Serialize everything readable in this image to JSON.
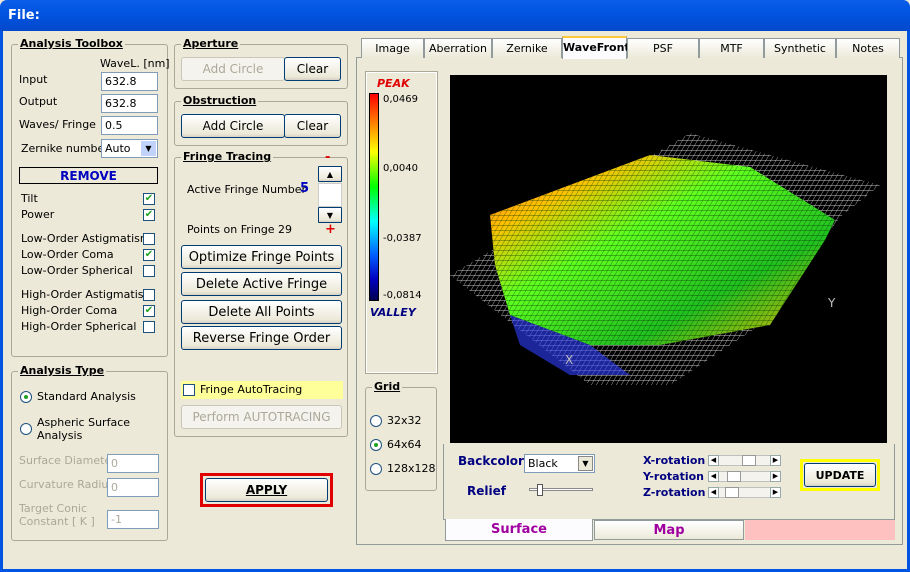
{
  "window": {
    "title": "File:"
  },
  "toolbox": {
    "title": "Analysis Toolbox",
    "wavel_header": "WaveL. [nm]",
    "input_label": "Input",
    "input_value": "632.8",
    "output_label": "Output",
    "output_value": "632.8",
    "waves_label": "Waves/ Fringe",
    "waves_value": "0.5",
    "zernike_label": "Zernike number",
    "zernike_value": "Auto",
    "remove_label": "REMOVE",
    "terms": [
      {
        "label": "Tilt",
        "checked": true
      },
      {
        "label": "Power",
        "checked": true
      },
      {
        "label": "Low-Order  Astigmatism",
        "checked": false
      },
      {
        "label": "Low-Order  Coma",
        "checked": true
      },
      {
        "label": "Low-Order  Spherical",
        "checked": false
      },
      {
        "label": "High-Order  Astigmatism",
        "checked": false
      },
      {
        "label": "High-Order  Coma",
        "checked": true
      },
      {
        "label": "High-Order  Spherical",
        "checked": false
      }
    ]
  },
  "analysis_type": {
    "title": "Analysis Type",
    "standard": "Standard  Analysis",
    "aspheric_line1": "Aspheric  Surface",
    "aspheric_line2": "Analysis",
    "surface_diameter_label": "Surface Diameter",
    "surface_diameter_value": "0",
    "curvature_radius_label": "Curvature Radius",
    "curvature_radius_value": "0",
    "conic_line1": "Target Conic",
    "conic_line2": "Constant [ K ]",
    "conic_value": "-1"
  },
  "aperture": {
    "title": "Aperture",
    "add": "Add Circle",
    "clear": "Clear"
  },
  "obstruction": {
    "title": "Obstruction",
    "add": "Add Circle",
    "clear": "Clear"
  },
  "fringe": {
    "title": "Fringe Tracing",
    "minus": "-",
    "plus": "+",
    "active_label": "Active Fringe Number",
    "active_value": "5",
    "points_label": "Points on  Fringe 29",
    "optimize": "Optimize Fringe Points",
    "delete_active": "Delete Active Fringe",
    "delete_all": "Delete  All Points",
    "reverse": "Reverse  Fringe Order",
    "autotracing": "Fringe AutoTracing",
    "perform": "Perform  AUTOTRACING"
  },
  "apply": "APPLY",
  "tabs": [
    "Image",
    "Aberration",
    "Zernike",
    "WaveFront",
    "PSF",
    "MTF",
    "Synthetic",
    "Notes"
  ],
  "scale": {
    "peak": "PEAK",
    "valley": "VALLEY",
    "ticks": [
      "0,0469",
      "0,0040",
      "-0,0387",
      "-0,0814"
    ]
  },
  "grid": {
    "title": "Grid",
    "options": [
      "32x32",
      "64x64",
      "128x128"
    ],
    "selected": "64x64"
  },
  "plot": {
    "x_axis": "X",
    "y_axis": "Y"
  },
  "controls": {
    "backcolor_label": "Backcolor",
    "backcolor_value": "Black",
    "relief_label": "Relief",
    "xrot": "X-rotation",
    "yrot": "Y-rotation",
    "zrot": "Z-rotation",
    "update": "UPDATE"
  },
  "bottom_tabs": {
    "surface": "Surface",
    "map": "Map"
  },
  "colors": {
    "peak": "#e00000",
    "valley": "#000080",
    "tab_label": "#a000a0",
    "apply_border": "#e00000",
    "update_border": "#ffff00"
  }
}
